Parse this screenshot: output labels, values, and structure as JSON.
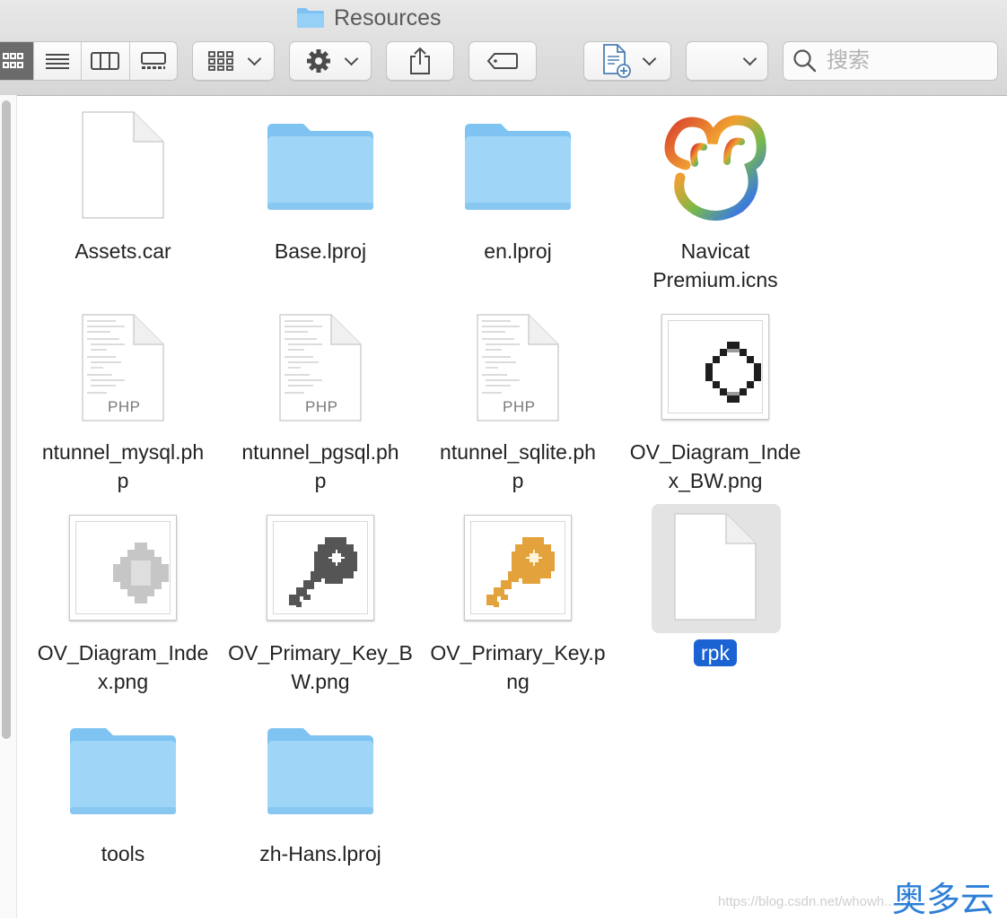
{
  "window": {
    "title": "Resources"
  },
  "toolbar": {
    "view_modes": [
      "icon-view",
      "list-view",
      "column-view",
      "gallery-view"
    ],
    "group_button": "group-by",
    "action_button": "action",
    "share_button": "share",
    "tags_button": "edit-tags",
    "new_doc_button": "new-document",
    "dropdown_value": "",
    "search_placeholder": "搜索"
  },
  "files": [
    {
      "name": "Assets.car",
      "kind": "document"
    },
    {
      "name": "Base.lproj",
      "kind": "folder"
    },
    {
      "name": "en.lproj",
      "kind": "folder"
    },
    {
      "name": "Navicat Premium.icns",
      "kind": "app-icon",
      "line1": "Navicat",
      "line2": "Premium.icns"
    },
    {
      "name": "ntunnel_mysql.php",
      "kind": "php",
      "line1": "ntunnel_mysql.ph",
      "line2": "p"
    },
    {
      "name": "ntunnel_pgsql.php",
      "kind": "php",
      "line1": "ntunnel_pgsql.ph",
      "line2": "p"
    },
    {
      "name": "ntunnel_sqlite.php",
      "kind": "php",
      "line1": "ntunnel_sqlite.ph",
      "line2": "p"
    },
    {
      "name": "OV_Diagram_Index_BW.png",
      "kind": "image",
      "line1": "OV_Diagram_Inde",
      "line2": "x_BW.png"
    },
    {
      "name": "OV_Diagram_Index.png",
      "kind": "image",
      "line1": "OV_Diagram_Inde",
      "line2": "x.png"
    },
    {
      "name": "OV_Primary_Key_BW.png",
      "kind": "image",
      "line1": "OV_Primary_Key_B",
      "line2": "W.png"
    },
    {
      "name": "OV_Primary_Key.png",
      "kind": "image",
      "line1": "OV_Primary_Key.p",
      "line2": "ng"
    },
    {
      "name": "rpk",
      "kind": "document",
      "selected": true
    },
    {
      "name": "tools",
      "kind": "folder"
    },
    {
      "name": "zh-Hans.lproj",
      "kind": "folder"
    }
  ],
  "php_tag": "PHP",
  "watermark": "https://blog.csdn.net/whowh...",
  "brand": "奥多云",
  "colors": {
    "selection": "#1b62d3",
    "folder": "#8fcdf5",
    "key_gold": "#e3a23b"
  }
}
